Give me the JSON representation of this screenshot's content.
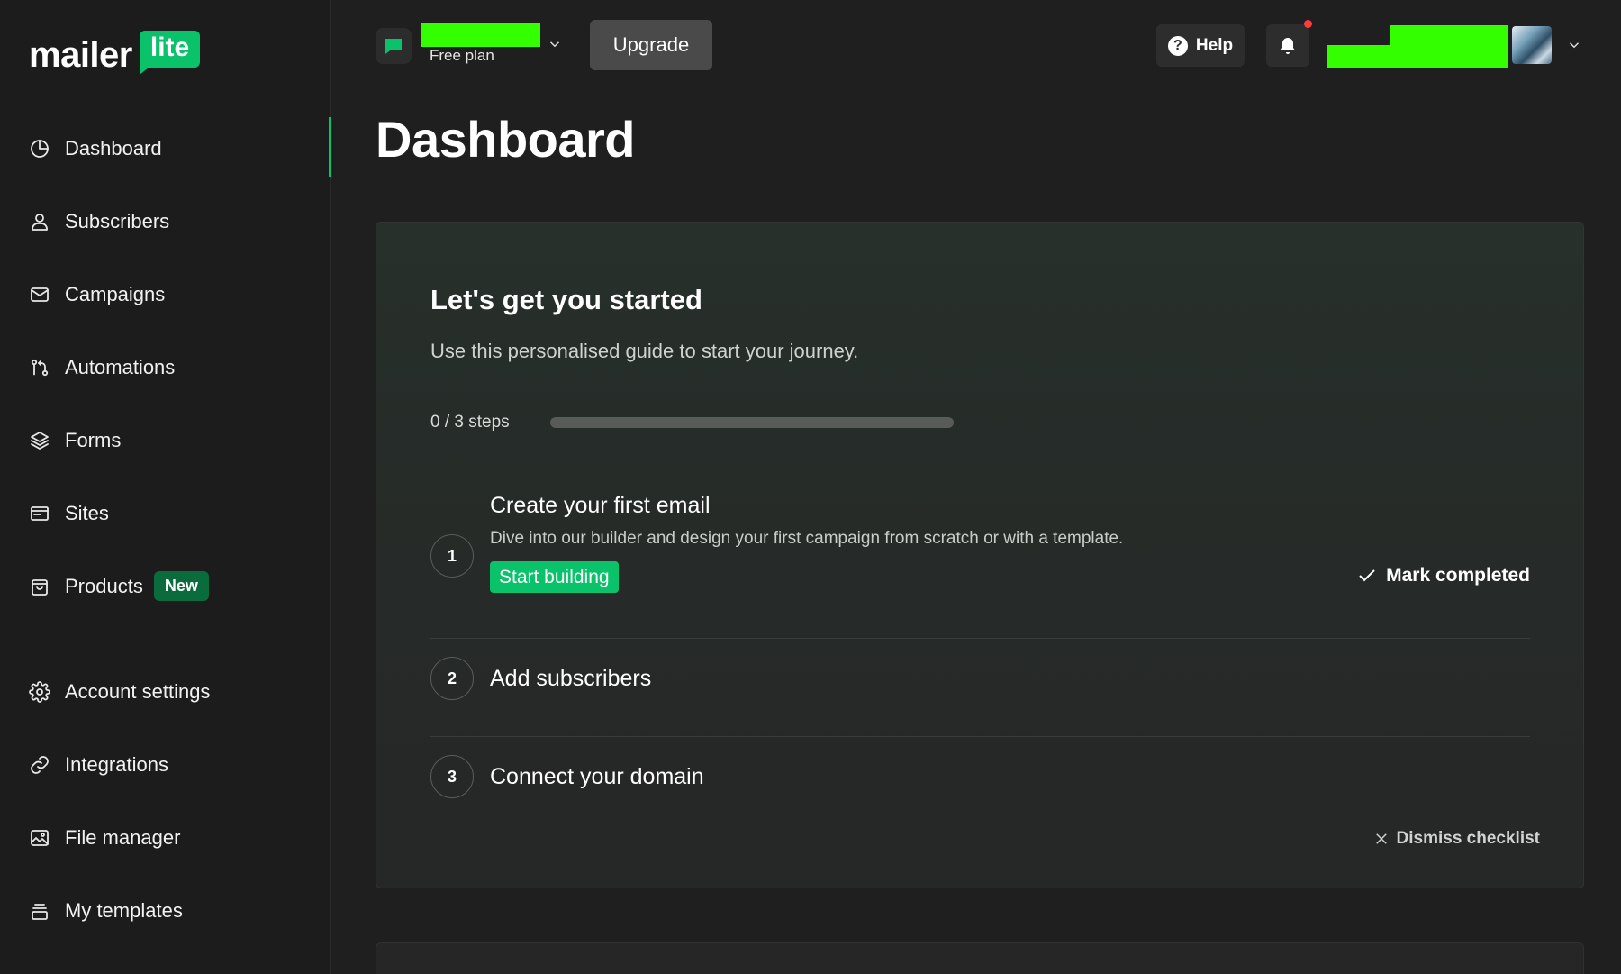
{
  "brand": {
    "word": "mailer",
    "badge": "lite",
    "accent": "#09c269"
  },
  "sidebar": {
    "items": [
      {
        "label": "Dashboard",
        "icon": "dashboard-icon",
        "active": true
      },
      {
        "label": "Subscribers",
        "icon": "user-icon"
      },
      {
        "label": "Campaigns",
        "icon": "mail-icon"
      },
      {
        "label": "Automations",
        "icon": "automation-icon"
      },
      {
        "label": "Forms",
        "icon": "layers-icon"
      },
      {
        "label": "Sites",
        "icon": "browser-icon"
      },
      {
        "label": "Products",
        "icon": "shopping-bag-icon",
        "badge": "New"
      }
    ],
    "settings_items": [
      {
        "label": "Account settings",
        "icon": "gear-icon"
      },
      {
        "label": "Integrations",
        "icon": "link-icon"
      },
      {
        "label": "File manager",
        "icon": "image-icon"
      },
      {
        "label": "My templates",
        "icon": "template-icon"
      }
    ]
  },
  "topbar": {
    "account_plan": "Free plan",
    "upgrade_label": "Upgrade",
    "help_label": "Help",
    "notification_dot_color": "#ff3b3b"
  },
  "page": {
    "title": "Dashboard"
  },
  "checklist": {
    "heading": "Let's get you started",
    "subtitle": "Use this personalised guide to start your journey.",
    "progress_text": "0 / 3 steps",
    "progress_fraction": 0,
    "steps": [
      {
        "number": "1",
        "title": "Create your first email",
        "description": "Dive into our builder and design your first campaign from scratch or with a template.",
        "action_label": "Start building",
        "mark_label": "Mark completed"
      },
      {
        "number": "2",
        "title": "Add subscribers"
      },
      {
        "number": "3",
        "title": "Connect your domain"
      }
    ],
    "dismiss_label": "Dismiss checklist"
  }
}
